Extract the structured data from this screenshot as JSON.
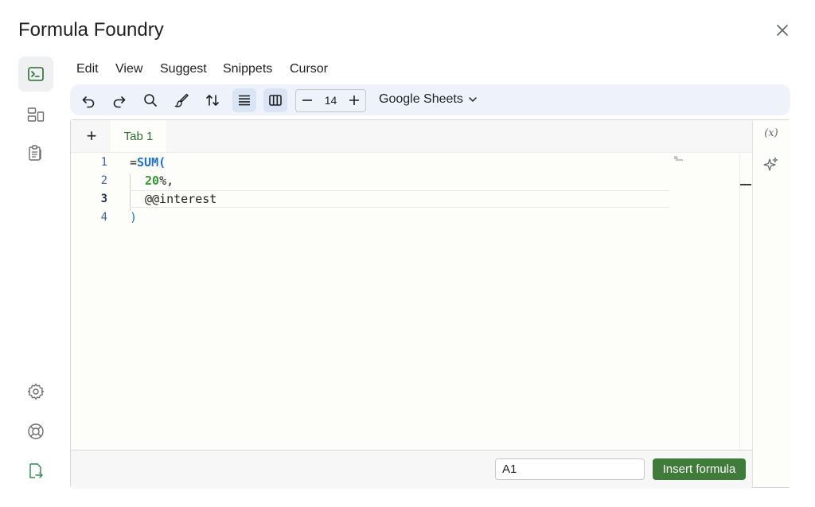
{
  "app": {
    "title": "Formula Foundry"
  },
  "menu": [
    "Edit",
    "View",
    "Suggest",
    "Snippets",
    "Cursor"
  ],
  "toolbar": {
    "font_size": "14",
    "target": "Google Sheets"
  },
  "tabs": {
    "add_label": "+",
    "active": "Tab 1"
  },
  "editor": {
    "line_numbers": [
      "1",
      "2",
      "3",
      "4"
    ],
    "code": {
      "l1_eq": "=",
      "l1_fn": "SUM(",
      "l2_num": "20",
      "l2_rest": "%,",
      "l3": "@@interest",
      "l4": ")"
    }
  },
  "rail": {
    "variables_label": "(x)"
  },
  "footer": {
    "cell_value": "A1",
    "insert_label": "Insert formula"
  },
  "colors": {
    "accent_green": "#3f7c3a",
    "function_blue": "#1a6fd8",
    "number_green": "#2f9a2f"
  }
}
